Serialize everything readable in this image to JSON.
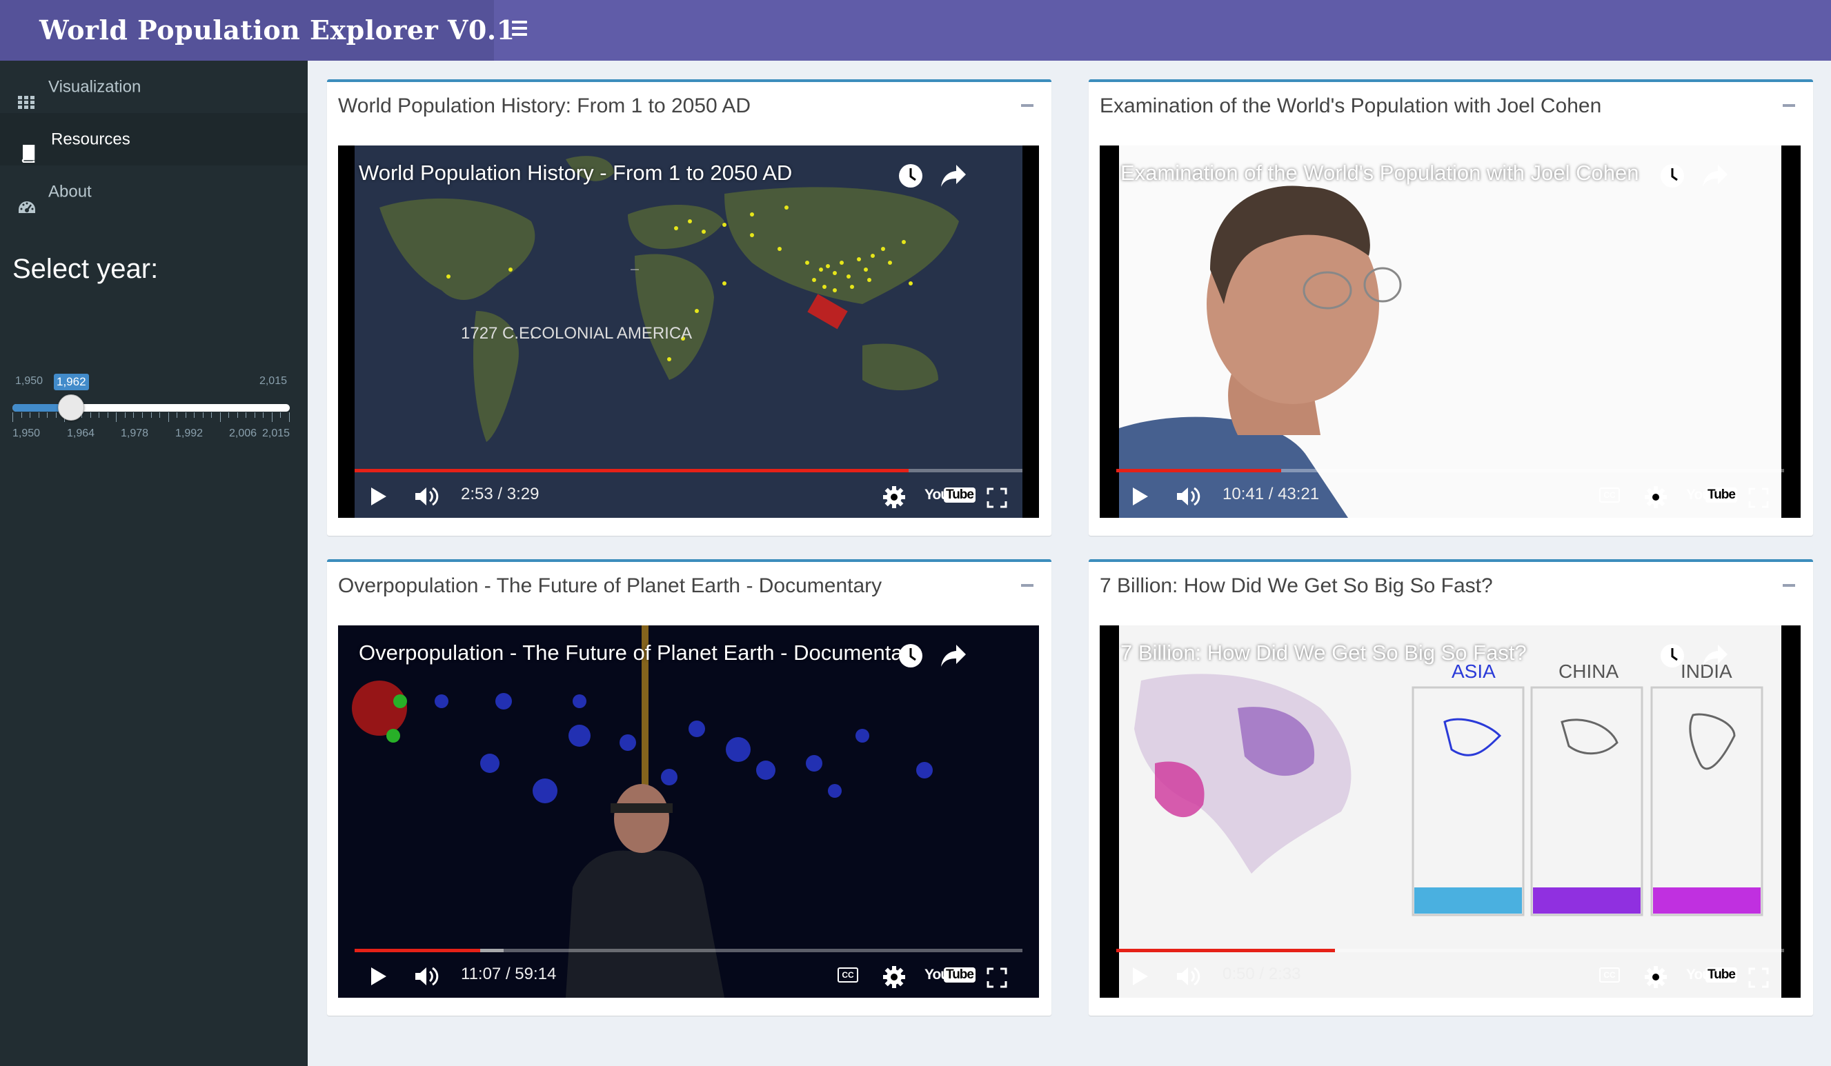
{
  "header": {
    "title": "World Population Explorer V0.1",
    "menu_icon": "hamburger-icon"
  },
  "sidebar": {
    "items": [
      {
        "label": "Visualization",
        "icon": "grid-icon",
        "active": false
      },
      {
        "label": "Resources",
        "icon": "book-icon",
        "active": true
      },
      {
        "label": "About",
        "icon": "dashboard-icon",
        "active": false
      }
    ],
    "slider": {
      "label": "Select year:",
      "min": "1,950",
      "max": "2,015",
      "value": "1,962",
      "value_number": 1962,
      "min_number": 1950,
      "max_number": 2015,
      "grid": [
        "1,950",
        "1,964",
        "1,978",
        "1,992",
        "2,006",
        "2,015"
      ]
    }
  },
  "boxes": [
    {
      "title": "World Population History: From 1 to 2050 AD",
      "video": {
        "title": "World Population History - From 1 to 2050 AD",
        "time": "2:53 / 3:29",
        "progress_fraction": 0.83,
        "cc": false
      }
    },
    {
      "title": "Examination of the World's Population with Joel Cohen",
      "video": {
        "title": "Examination of the World's Population with Joel Cohen",
        "time": "10:41 / 43:21",
        "progress_fraction": 0.247,
        "cc": true
      }
    },
    {
      "title": "Overpopulation - The Future of Planet Earth - Documentary",
      "video": {
        "title": "Overpopulation - The Future of Planet Earth - Documentary",
        "time": "11:07 / 59:14",
        "progress_fraction": 0.188,
        "cc": true
      }
    },
    {
      "title": "7 Billion: How Did We Get So Big So Fast?",
      "video": {
        "title": "7 Billion: How Did We Get So Big So Fast?",
        "time": "0:50 / 2:33",
        "progress_fraction": 0.327,
        "cc": true,
        "scene_labels": [
          "ASIA",
          "CHINA",
          "INDIA"
        ]
      }
    }
  ],
  "video_controls": {
    "youtube_you": "You",
    "youtube_tube": "Tube",
    "cc_label": "CC"
  },
  "scene_text": {
    "year": "1727 C.E.",
    "era": "COLONIAL AMERICA"
  },
  "colors": {
    "header": "#605ca8",
    "logo_bg": "#555299",
    "sidebar": "#222d32",
    "accent": "#3c8dbc",
    "progress": "#e62117"
  }
}
